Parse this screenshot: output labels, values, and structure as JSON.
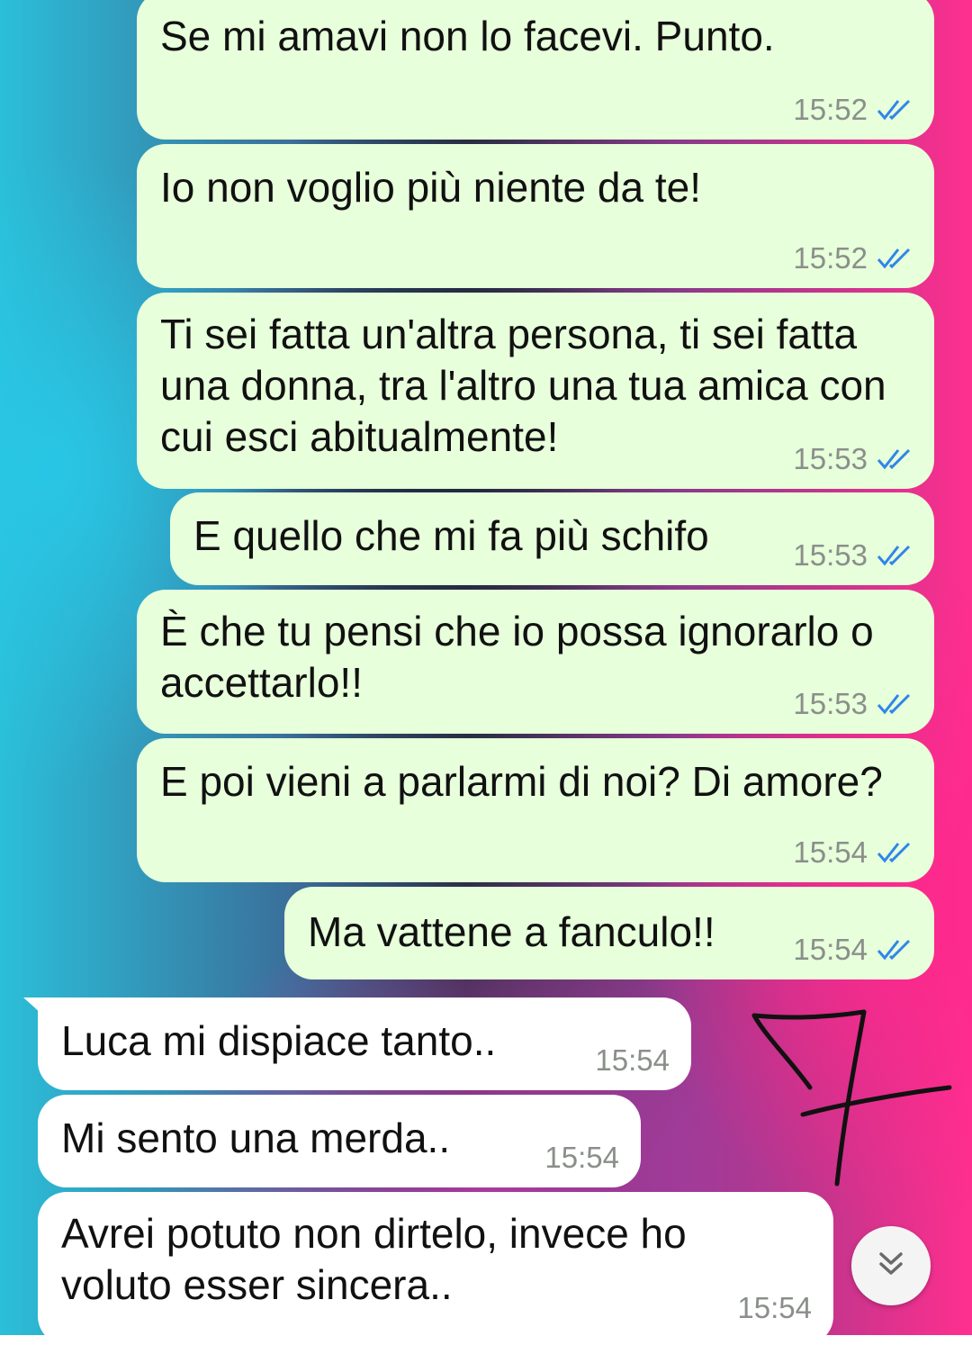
{
  "colors": {
    "outgoing_bubble": "#e7ffdb",
    "incoming_bubble": "#ffffff",
    "read_tick": "#2f86e8",
    "timestamp": "#8a8f8a",
    "annotation_stroke": "#111111"
  },
  "messages": [
    {
      "direction": "outgoing",
      "text": "Se mi amavi non lo facevi. Punto.",
      "time": "15:52",
      "status": "read-double-tick-icon"
    },
    {
      "direction": "outgoing",
      "text": "Io non voglio più niente da te!",
      "time": "15:52",
      "status": "read-double-tick-icon"
    },
    {
      "direction": "outgoing",
      "text": "Ti sei fatta un'altra persona, ti sei fatta una donna, tra l'altro una tua amica con cui esci abitualmente!",
      "time": "15:53",
      "status": "read-double-tick-icon"
    },
    {
      "direction": "outgoing",
      "text": "E quello che mi fa più schifo",
      "time": "15:53",
      "status": "read-double-tick-icon"
    },
    {
      "direction": "outgoing",
      "text": "È che tu pensi che io possa ignorarlo o accettarlo!!",
      "time": "15:53",
      "status": "read-double-tick-icon"
    },
    {
      "direction": "outgoing",
      "text": "E poi vieni a parlarmi di noi? Di amore?",
      "time": "15:54",
      "status": "read-double-tick-icon"
    },
    {
      "direction": "outgoing",
      "text": "Ma vattene a fanculo!!",
      "time": "15:54",
      "status": "read-double-tick-icon"
    },
    {
      "direction": "incoming",
      "text": "Luca mi dispiace tanto..",
      "time": "15:54"
    },
    {
      "direction": "incoming",
      "text": "Mi sento una merda..",
      "time": "15:54"
    },
    {
      "direction": "incoming",
      "text": "Avrei potuto non dirtelo, invece ho voluto esser sincera..",
      "time": "15:54"
    }
  ],
  "scroll_to_bottom": {
    "icon": "double-chevron-down-icon"
  },
  "annotation": {
    "icon": "handwritten-seven-icon"
  }
}
